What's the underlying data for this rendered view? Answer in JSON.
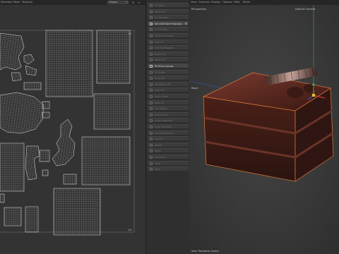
{
  "uv_menu": {
    "items": [
      "Selection",
      "Mesh",
      "Textures"
    ]
  },
  "project_select": {
    "value": "Project"
  },
  "uv_corners": {
    "top_right": "1,1",
    "bottom_right": "1,0"
  },
  "tools": [
    {
      "label": "UV Tools",
      "active": false
    },
    {
      "label": "Relax UV",
      "active": false
    },
    {
      "label": "UV Manager",
      "active": false
    },
    {
      "label": "Set UVW from Projection",
      "active": true
    },
    {
      "label": "UV Unwrap",
      "active": false
    },
    {
      "label": "Fit UV to Canvas",
      "active": false
    },
    {
      "label": "Pack UV",
      "active": false
    },
    {
      "label": "Optimal Mapping",
      "active": false
    },
    {
      "label": "Rotate UV",
      "active": false
    },
    {
      "label": "Mirror UV",
      "active": false
    },
    {
      "label": "Fit UV to Canvas",
      "active": true
    },
    {
      "label": "UV Shells",
      "active": false
    },
    {
      "label": "Scale UV",
      "active": false
    },
    {
      "label": "Straighten UV",
      "active": false
    },
    {
      "label": "Align UV",
      "active": false
    },
    {
      "label": "Stack Shells",
      "active": false
    },
    {
      "label": "Weld UV",
      "active": false
    },
    {
      "label": "Cut Seams",
      "active": false
    },
    {
      "label": "Select Shell",
      "active": false
    },
    {
      "label": "Invert Selection",
      "active": false
    },
    {
      "label": "Grow Selection",
      "active": false
    },
    {
      "label": "Shrink Selection",
      "active": false
    },
    {
      "label": "Layout",
      "active": false
    },
    {
      "label": "Distort",
      "active": false
    },
    {
      "label": "Relax",
      "active": false
    },
    {
      "label": "Transform",
      "active": false
    },
    {
      "label": "Snap",
      "active": false
    },
    {
      "label": "Texel",
      "active": false
    }
  ],
  "viewport_menu": {
    "items": [
      "View",
      "Cameras",
      "Display",
      "Options",
      "Filter",
      "Panel"
    ]
  },
  "viewport": {
    "mode_label": "Perspective",
    "camera_label": "Default Camera",
    "move_label": "Move",
    "footer": "View Transform: Scene"
  },
  "colors": {
    "cake_dark": "#2a1410",
    "cake_mid": "#5a2a22",
    "selection_orange": "#e07a3a",
    "axis_green": "#3fbf5a",
    "axis_blue": "#3a5bd8",
    "axis_red": "#d84a3a"
  }
}
